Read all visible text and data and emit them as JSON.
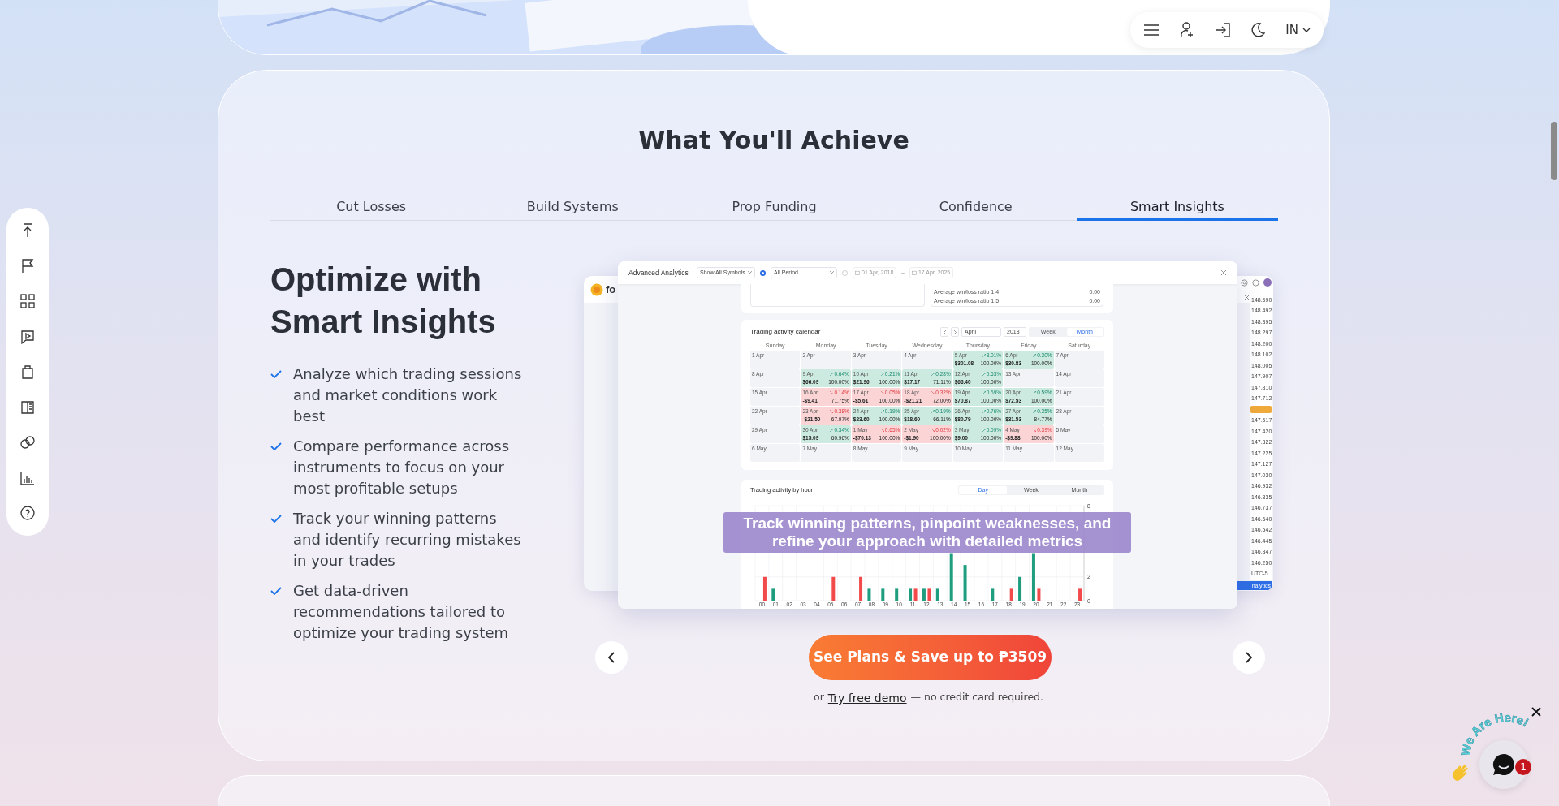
{
  "top_nav": {
    "language": "IN"
  },
  "section": {
    "title": "What You'll Achieve",
    "tabs": [
      {
        "label": "Cut Losses",
        "selected": false
      },
      {
        "label": "Build Systems",
        "selected": false
      },
      {
        "label": "Prop Funding",
        "selected": false
      },
      {
        "label": "Confidence",
        "selected": false
      },
      {
        "label": "Smart Insights",
        "selected": true
      }
    ],
    "heading": "Optimize with Smart Insights",
    "points": [
      "Analyze which trading sessions and market conditions work best",
      "Compare performance across instruments to focus on your most profitable setups",
      "Track your winning patterns and identify recurring mistakes in your trades",
      "Get data-driven recommendations tailored to optimize your trading system"
    ],
    "caption": "Track winning patterns, pinpoint weaknesses, and refine your approach with detailed metrics",
    "cta": "See Plans & Save up to ₱3509",
    "demo": {
      "prefix": "or",
      "link": "Try free demo",
      "suffix": "— no credit card required."
    }
  },
  "app_screenshot": {
    "back_window": {
      "logo_text": "fo",
      "prices": [
        {
          "kind": "label",
          "text": "148.590"
        },
        {
          "kind": "label",
          "text": "148.492"
        },
        {
          "kind": "label",
          "text": "148.395"
        },
        {
          "kind": "label",
          "text": "148.297"
        },
        {
          "kind": "label",
          "text": "148.200"
        },
        {
          "kind": "label",
          "text": "148.102"
        },
        {
          "kind": "label",
          "text": "148.005"
        },
        {
          "kind": "label",
          "text": "147.907"
        },
        {
          "kind": "label",
          "text": "147.810"
        },
        {
          "kind": "label",
          "text": "147.712"
        },
        {
          "kind": "marker"
        },
        {
          "kind": "label",
          "text": "147.517"
        },
        {
          "kind": "label",
          "text": "147.420"
        },
        {
          "kind": "label",
          "text": "147.322"
        },
        {
          "kind": "label",
          "text": "147.225"
        },
        {
          "kind": "label",
          "text": "147.127"
        },
        {
          "kind": "label",
          "text": "147.030"
        },
        {
          "kind": "label",
          "text": "146.932"
        },
        {
          "kind": "label",
          "text": "146.835"
        },
        {
          "kind": "label",
          "text": "146.737"
        },
        {
          "kind": "label",
          "text": "146.640"
        },
        {
          "kind": "label",
          "text": "146.542"
        },
        {
          "kind": "label",
          "text": "146.445"
        },
        {
          "kind": "label",
          "text": "146.347"
        },
        {
          "kind": "label",
          "text": "146.250"
        }
      ],
      "timezone": "UTC-5",
      "button": "nalytics"
    },
    "window": {
      "title": "Advanced Analytics",
      "symbol_filter": "Show All Symbols",
      "periods": [
        {
          "kind": "preset",
          "label": "All Period",
          "selected": true
        },
        {
          "kind": "range",
          "from": "01 Apr, 2018",
          "separator": "–",
          "to": "17 Apr, 2025",
          "selected": false
        }
      ]
    },
    "ratios": [
      {
        "label": "Average win/loss ratio 1:4",
        "value": "0.00"
      },
      {
        "label": "Average win/loss ratio 1:5",
        "value": "0.00"
      }
    ],
    "calendar": {
      "title": "Trading activity calendar",
      "month": "April",
      "year": "2018",
      "views": [
        {
          "label": "Week",
          "selected": false
        },
        {
          "label": "Month",
          "selected": true
        }
      ],
      "weekdays": [
        "Sunday",
        "Monday",
        "Tuesday",
        "Wednesday",
        "Thursday",
        "Friday",
        "Saturday"
      ],
      "weeks": [
        [
          {
            "date": "1 Apr",
            "kind": "empty"
          },
          {
            "date": "2 Apr",
            "kind": "empty"
          },
          {
            "date": "3 Apr",
            "kind": "empty"
          },
          {
            "date": "4 Apr",
            "kind": "empty"
          },
          {
            "date": "5 Apr",
            "kind": "gain",
            "change": "3.01%",
            "amount": "$301.08",
            "win_rate": "100.00%"
          },
          {
            "date": "6 Apr",
            "kind": "gain",
            "change": "0.30%",
            "amount": "$30.83",
            "win_rate": "100.00%"
          },
          {
            "date": "7 Apr",
            "kind": "empty"
          }
        ],
        [
          {
            "date": "8 Apr",
            "kind": "empty"
          },
          {
            "date": "9 Apr",
            "kind": "gain",
            "change": "0.64%",
            "amount": "$66.09",
            "win_rate": "100.00%"
          },
          {
            "date": "10 Apr",
            "kind": "gain",
            "change": "0.21%",
            "amount": "$21.96",
            "win_rate": "100.00%"
          },
          {
            "date": "11 Apr",
            "kind": "gain",
            "change": "0.28%",
            "amount": "$17.17",
            "win_rate": "71.11%"
          },
          {
            "date": "12 Apr",
            "kind": "gain",
            "change": "0.63%",
            "amount": "$66.40",
            "win_rate": "100.00%"
          },
          {
            "date": "13 Apr",
            "kind": "empty"
          },
          {
            "date": "14 Apr",
            "kind": "empty"
          }
        ],
        [
          {
            "date": "15 Apr",
            "kind": "empty"
          },
          {
            "date": "16 Apr",
            "kind": "loss",
            "change": "0.14%",
            "amount": "-$9.41",
            "win_rate": "71.75%"
          },
          {
            "date": "17 Apr",
            "kind": "loss",
            "change": "0.05%",
            "amount": "-$5.61",
            "win_rate": "100.00%"
          },
          {
            "date": "18 Apr",
            "kind": "loss",
            "change": "0.32%",
            "amount": "-$21.21",
            "win_rate": "72.00%"
          },
          {
            "date": "19 Apr",
            "kind": "gain",
            "change": "0.69%",
            "amount": "$70.87",
            "win_rate": "100.00%"
          },
          {
            "date": "20 Apr",
            "kind": "gain",
            "change": "0.59%",
            "amount": "$72.53",
            "win_rate": "100.00%"
          },
          {
            "date": "21 Apr",
            "kind": "empty"
          }
        ],
        [
          {
            "date": "22 Apr",
            "kind": "empty"
          },
          {
            "date": "23 Apr",
            "kind": "loss",
            "change": "0.38%",
            "amount": "-$21.50",
            "win_rate": "67.97%"
          },
          {
            "date": "24 Apr",
            "kind": "gain",
            "change": "0.19%",
            "amount": "$23.60",
            "win_rate": "100.00%"
          },
          {
            "date": "25 Apr",
            "kind": "gain",
            "change": "0.19%",
            "amount": "$18.60",
            "win_rate": "66.11%"
          },
          {
            "date": "26 Apr",
            "kind": "gain",
            "change": "0.76%",
            "amount": "$80.79",
            "win_rate": "100.00%"
          },
          {
            "date": "27 Apr",
            "kind": "gain",
            "change": "0.35%",
            "amount": "$31.53",
            "win_rate": "84.77%"
          },
          {
            "date": "28 Apr",
            "kind": "empty"
          }
        ],
        [
          {
            "date": "29 Apr",
            "kind": "empty"
          },
          {
            "date": "30 Apr",
            "kind": "gain",
            "change": "0.34%",
            "amount": "$15.09",
            "win_rate": "60.96%"
          },
          {
            "date": "1 May",
            "kind": "loss",
            "change": "0.65%",
            "amount": "-$70.13",
            "win_rate": "100.00%"
          },
          {
            "date": "2 May",
            "kind": "loss",
            "change": "0.02%",
            "amount": "-$1.90",
            "win_rate": "100.00%"
          },
          {
            "date": "3 May",
            "kind": "gain",
            "change": "0.09%",
            "amount": "$9.00",
            "win_rate": "100.00%"
          },
          {
            "date": "4 May",
            "kind": "loss",
            "change": "0.39%",
            "amount": "-$9.88",
            "win_rate": "100.00%"
          },
          {
            "date": "5 May",
            "kind": "empty"
          }
        ],
        [
          {
            "date": "6 May",
            "kind": "empty"
          },
          {
            "date": "7 May",
            "kind": "empty"
          },
          {
            "date": "8 May",
            "kind": "empty"
          },
          {
            "date": "9 May",
            "kind": "empty"
          },
          {
            "date": "10 May",
            "kind": "empty"
          },
          {
            "date": "11 May",
            "kind": "empty"
          },
          {
            "date": "12 May",
            "kind": "empty"
          }
        ]
      ]
    },
    "hourly": {
      "title": "Trading activity by hour",
      "views": [
        {
          "label": "Day",
          "selected": true
        },
        {
          "label": "Week",
          "selected": false
        },
        {
          "label": "Month",
          "selected": false
        }
      ],
      "chart_data": {
        "type": "bar",
        "categories": [
          "00",
          "01",
          "02",
          "03",
          "04",
          "05",
          "06",
          "07",
          "08",
          "09",
          "10",
          "11",
          "12",
          "13",
          "14",
          "15",
          "16",
          "17",
          "18",
          "19",
          "20",
          "21",
          "22",
          "23"
        ],
        "series": [
          {
            "color": "#1f9e7f",
            "values": [
              0,
              1,
              0,
              0,
              0,
              0,
              0,
              0,
              1,
              1,
              1,
              1,
              1,
              1,
              4,
              3,
              0,
              1,
              0,
              2,
              4,
              0,
              0,
              0
            ]
          },
          {
            "color": "#f24a4a",
            "values": [
              2,
              0,
              0,
              0,
              0,
              2,
              0,
              2,
              0,
              0,
              0,
              1,
              1,
              0,
              0,
              0,
              0,
              0,
              1,
              0,
              1,
              0,
              0,
              1
            ]
          }
        ],
        "ylim": [
          0,
          8
        ],
        "yticks": [
          0,
          2,
          8
        ]
      }
    }
  },
  "chat": {
    "greeting": "We Are Here!",
    "badge": "1"
  }
}
